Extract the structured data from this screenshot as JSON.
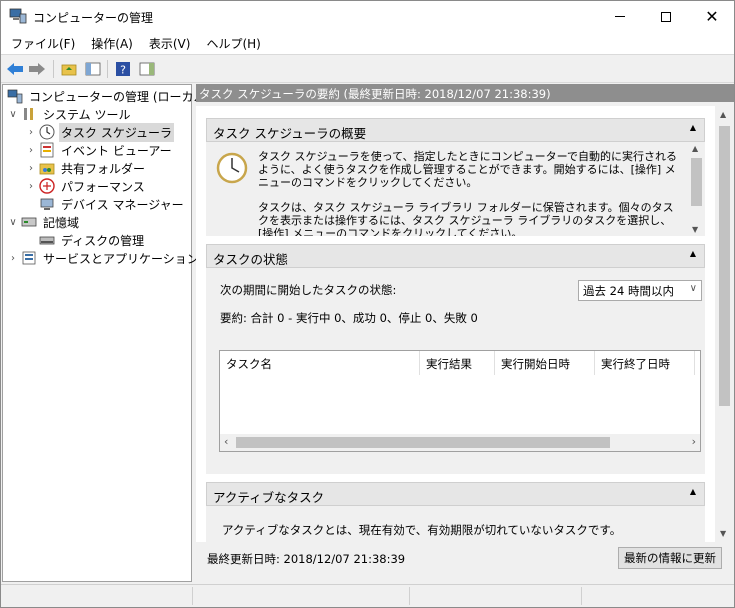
{
  "window": {
    "title": "コンピューターの管理"
  },
  "menu": [
    "ファイル(F)",
    "操作(A)",
    "表示(V)",
    "ヘルプ(H)"
  ],
  "tree": {
    "root": "コンピューターの管理 (ローカル)",
    "system_tools": "システム ツール",
    "task_scheduler": "タスク スケジューラ",
    "event_viewer": "イベント ビューアー",
    "shared_folders": "共有フォルダー",
    "performance": "パフォーマンス",
    "device_manager": "デバイス マネージャー",
    "storage": "記憶域",
    "disk_management": "ディスクの管理",
    "services_apps": "サービスとアプリケーション"
  },
  "right": {
    "header": "タスク スケジューラの要約 (最終更新日時: 2018/12/07 21:38:39)",
    "overview": {
      "title": "タスク スケジューラの概要",
      "para1": "タスク スケジューラを使って、指定したときにコンピューターで自動的に実行されるように、よく使うタスクを作成し管理することができます。開始するには、[操作] メニューのコマンドをクリックしてください。",
      "para2": "タスクは、タスク スケジューラ ライブラリ フォルダーに保管されます。個々のタスクを表示または操作するには、タスク スケジューラ ライブラリのタスクを選択し、[操作] メニューのコマンドをクリックしてください。"
    },
    "status": {
      "title": "タスクの状態",
      "period_label": "次の期間に開始したタスクの状態:",
      "period_value": "過去 24 時間以内",
      "summary": "要約: 合計 0 - 実行中 0、成功 0、停止 0、失敗 0",
      "columns": [
        "タスク名",
        "実行結果",
        "実行開始日時",
        "実行終了日時"
      ]
    },
    "active": {
      "title": "アクティブなタスク",
      "text": "アクティブなタスクとは、現在有効で、有効期限が切れていないタスクです。"
    },
    "last_updated": "最終更新日時: 2018/12/07 21:38:39",
    "refresh_label": "最新の情報に更新"
  }
}
